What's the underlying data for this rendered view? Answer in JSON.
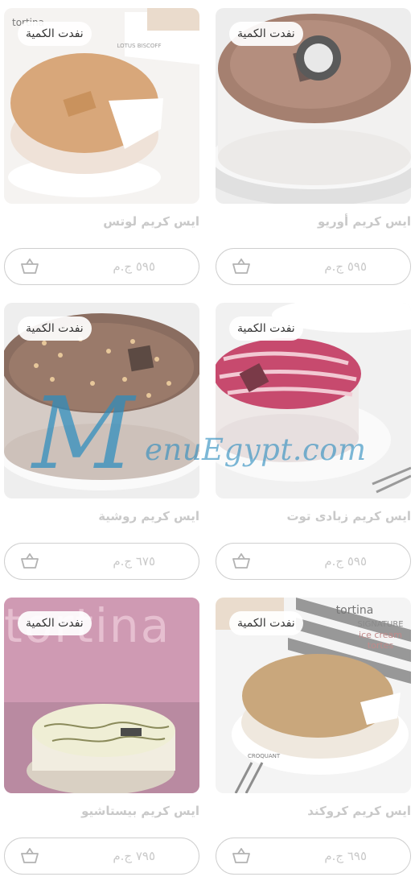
{
  "products": [
    {
      "name": "ايس كريم أوريو",
      "price": "٥٩٥ ج.م",
      "badge": "نفدت الكمية"
    },
    {
      "name": "ايس كريم لوتس",
      "price": "٥٩٥ ج.م",
      "badge": "نفدت الكمية"
    },
    {
      "name": "ايس كريم زبادى توت",
      "price": "٥٩٥ ج.م",
      "badge": "نفدت الكمية"
    },
    {
      "name": "ايس كريم روشية",
      "price": "٦٧٥ ج.م",
      "badge": "نفدت الكمية"
    },
    {
      "name": "ايس كريم كروكند",
      "price": "٦٩٥ ج.م",
      "badge": "نفدت الكمية"
    },
    {
      "name": "ايس كريم بيستاشيو",
      "price": "٧٩٥ ج.م",
      "badge": "نفدت الكمية"
    }
  ],
  "photo_text": {
    "lotus_brand": "tortina",
    "lotus_label": "LOTUS BISCOFF",
    "signature_brand": "tortina",
    "signature_line1": "SIGNATURE",
    "signature_line2": "ice cream",
    "signature_line3": "tortes",
    "croquant_label": "CROQUANT",
    "pistachio_wall": "tortina"
  },
  "watermark": {
    "mark": "M",
    "text": "enuEgypt.com"
  },
  "icons": {
    "basket": "basket-icon"
  }
}
